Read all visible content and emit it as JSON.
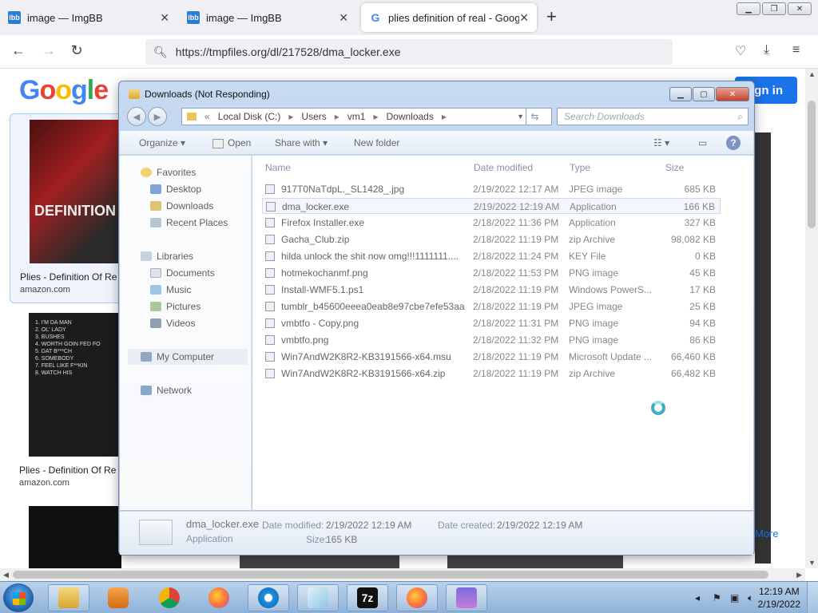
{
  "browser": {
    "tabs": [
      {
        "label": "image — ImgBB",
        "icon": "imgbb-icon"
      },
      {
        "label": "image — ImgBB",
        "icon": "imgbb-icon"
      },
      {
        "label": "plies definition of real - Google",
        "icon": "google-icon"
      }
    ],
    "url": "https://tmpfiles.org/dl/217528/dma_locker.exe"
  },
  "google": {
    "sign_in": "Sign in",
    "results": [
      {
        "title": "Plies - Definition Of Re",
        "source": "amazon.com"
      },
      {
        "title": "Plies - Definition Of Re",
        "source": "amazon.com"
      }
    ],
    "more": "More"
  },
  "explorer": {
    "title": "Downloads (Not Responding)",
    "breadcrumb": [
      "Local Disk (C:)",
      "Users",
      "vm1",
      "Downloads"
    ],
    "search_placeholder": "Search Downloads",
    "toolbar": {
      "organize": "Organize",
      "open": "Open",
      "share": "Share with",
      "new_folder": "New folder"
    },
    "nav": {
      "favorites": "Favorites",
      "desktop": "Desktop",
      "downloads": "Downloads",
      "recent": "Recent Places",
      "libraries": "Libraries",
      "documents": "Documents",
      "music": "Music",
      "pictures": "Pictures",
      "videos": "Videos",
      "computer": "My Computer",
      "network": "Network"
    },
    "columns": {
      "name": "Name",
      "date": "Date modified",
      "type": "Type",
      "size": "Size"
    },
    "files": [
      {
        "name": "917T0NaTdpL._SL1428_.jpg",
        "date": "2/19/2022 12:17 AM",
        "type": "JPEG image",
        "size": "685 KB"
      },
      {
        "name": "dma_locker.exe",
        "date": "2/19/2022 12:19 AM",
        "type": "Application",
        "size": "166 KB"
      },
      {
        "name": "Firefox Installer.exe",
        "date": "2/18/2022 11:36 PM",
        "type": "Application",
        "size": "327 KB"
      },
      {
        "name": "Gacha_Club.zip",
        "date": "2/18/2022 11:19 PM",
        "type": "zip Archive",
        "size": "98,082 KB"
      },
      {
        "name": "hilda unlock the shit now omg!!!1111111....",
        "date": "2/18/2022 11:24 PM",
        "type": "KEY File",
        "size": "0 KB"
      },
      {
        "name": "hotmekochanmf.png",
        "date": "2/18/2022 11:53 PM",
        "type": "PNG image",
        "size": "45 KB"
      },
      {
        "name": "Install-WMF5.1.ps1",
        "date": "2/18/2022 11:19 PM",
        "type": "Windows PowerS...",
        "size": "17 KB"
      },
      {
        "name": "tumblr_b45600eeea0eab8e97cbe7efe53aa...",
        "date": "2/18/2022 11:19 PM",
        "type": "JPEG image",
        "size": "25 KB"
      },
      {
        "name": "vmbtfo - Copy.png",
        "date": "2/18/2022 11:31 PM",
        "type": "PNG image",
        "size": "94 KB"
      },
      {
        "name": "vmbtfo.png",
        "date": "2/18/2022 11:32 PM",
        "type": "PNG image",
        "size": "86 KB"
      },
      {
        "name": "Win7AndW2K8R2-KB3191566-x64.msu",
        "date": "2/18/2022 11:19 PM",
        "type": "Microsoft Update ...",
        "size": "66,460 KB"
      },
      {
        "name": "Win7AndW2K8R2-KB3191566-x64.zip",
        "date": "2/18/2022 11:19 PM",
        "type": "zip Archive",
        "size": "66,482 KB"
      }
    ],
    "details": {
      "name": "dma_locker.exe",
      "type": "Application",
      "modified_label": "Date modified:",
      "modified": "2/19/2022 12:19 AM",
      "created_label": "Date created:",
      "created": "2/19/2022 12:19 AM",
      "size_label": "Size:",
      "size": "165 KB"
    }
  },
  "taskbar": {
    "time": "12:19 AM",
    "date": "2/19/2022",
    "sevenzip": "7z"
  }
}
